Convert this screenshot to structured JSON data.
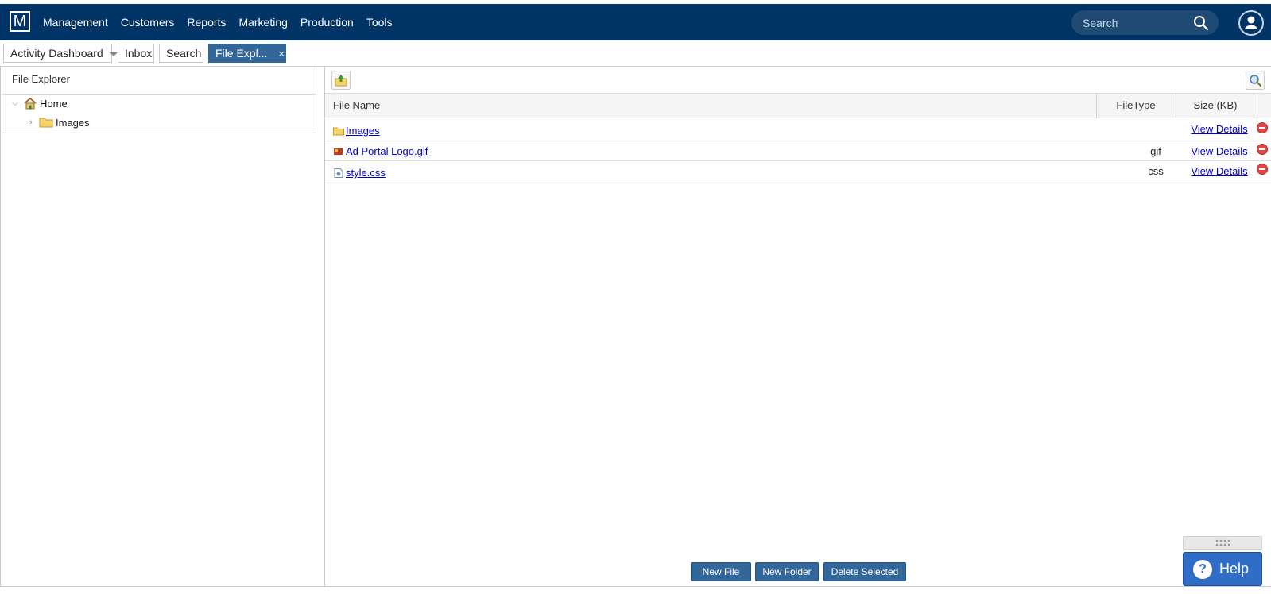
{
  "app": {
    "logo_letter": "M"
  },
  "nav": {
    "items": [
      "Management",
      "Customers",
      "Reports",
      "Marketing",
      "Production",
      "Tools"
    ],
    "search_placeholder": "Search"
  },
  "tabs": [
    {
      "label": "Activity Dashboard",
      "has_dropdown": true
    },
    {
      "label": "Inbox"
    },
    {
      "label": "Search"
    },
    {
      "label": "File Expl...",
      "active": true,
      "close": "×"
    }
  ],
  "left_panel": {
    "title": "File Explorer",
    "tree": [
      {
        "label": "Home",
        "expanded": true,
        "toggle": "⌵"
      },
      {
        "label": "Images",
        "toggle": "›"
      }
    ]
  },
  "grid": {
    "headers": {
      "name": "File Name",
      "type": "FileType",
      "size": "Size (KB)"
    },
    "rows": [
      {
        "name": "Images",
        "type": "",
        "details": "View Details",
        "icon": "folder-icon"
      },
      {
        "name": "Ad Portal Logo.gif",
        "type": "gif",
        "details": "View Details",
        "icon": "image-file-icon"
      },
      {
        "name": "style.css",
        "type": "css",
        "details": "View Details",
        "icon": "css-file-icon"
      }
    ]
  },
  "buttons": {
    "new_file": "New File",
    "new_folder": "New Folder",
    "delete_selected": "Delete Selected"
  },
  "help": {
    "label": "Help",
    "glyph": "?"
  },
  "colors": {
    "nav_bg": "#003366",
    "accent": "#336699",
    "help": "#2f6dc6",
    "link": "#0000cc",
    "delete": "#e04848"
  }
}
